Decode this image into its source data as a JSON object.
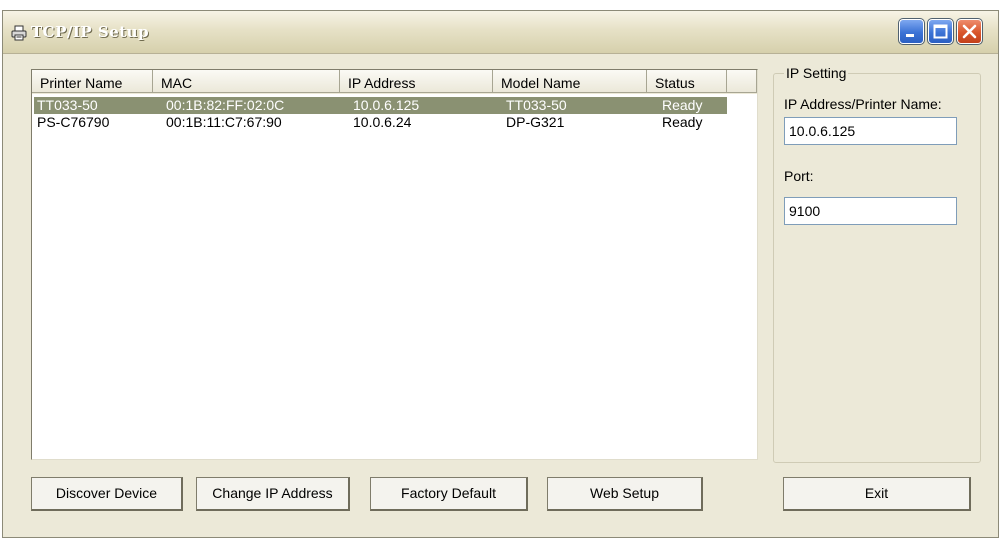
{
  "window": {
    "title": "TCP/IP Setup",
    "icon": "printer-icon",
    "controls": [
      "minimize-icon",
      "maximize-icon",
      "close-icon"
    ],
    "accent_color": "#3c73d6",
    "close_color": "#d9562b"
  },
  "device_list": {
    "columns": [
      "Printer Name",
      "MAC",
      "IP Address",
      "Model Name",
      "Status"
    ],
    "rows": [
      {
        "printer_name": "TT033-50",
        "mac": "00:1B:82:FF:02:0C",
        "ip": "10.0.6.125",
        "model": "TT033-50",
        "status": "Ready",
        "selected": true
      },
      {
        "printer_name": "PS-C76790",
        "mac": "00:1B:11:C7:67:90",
        "ip": "10.0.6.24",
        "model": "DP-G321",
        "status": "Ready",
        "selected": false
      }
    ],
    "selection_color": "#8a9172"
  },
  "ip_setting": {
    "group_title": "IP Setting",
    "address_label": "IP Address/Printer Name:",
    "address_value": "10.0.6.125",
    "port_label": "Port:",
    "port_value": "9100"
  },
  "buttons": {
    "discover": "Discover Device",
    "change_ip": "Change IP Address",
    "factory_default": "Factory Default",
    "web_setup": "Web Setup",
    "exit": "Exit"
  }
}
